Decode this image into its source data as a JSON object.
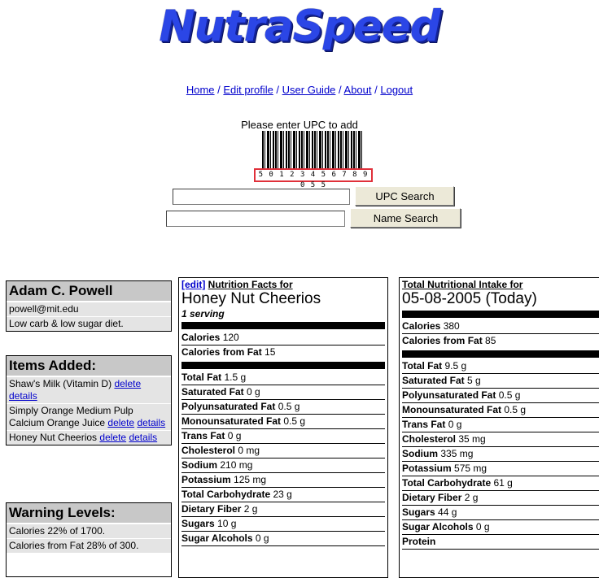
{
  "app": {
    "logo": "NutraSpeed"
  },
  "nav": {
    "items": [
      "Home",
      "Edit profile",
      "User Guide",
      "About",
      "Logout"
    ],
    "separator": " / "
  },
  "upc": {
    "prompt": "Please enter UPC to add",
    "barcode_digits": "5 0 1 2 3 4 5 6 7 8 9 0 5 5",
    "upc_input_value": "",
    "upc_button": "UPC Search",
    "name_input_value": "",
    "name_button": "Name Search"
  },
  "profile": {
    "name": "Adam C. Powell",
    "email": "powell@mit.edu",
    "diet": "Low carb & low sugar diet."
  },
  "items_added": {
    "title": "Items Added:",
    "items": [
      {
        "name": "Shaw's Milk (Vitamin D)",
        "delete": "delete",
        "details": "details"
      },
      {
        "name": "Simply Orange Medium Pulp Calcium Orange Juice",
        "delete": "delete",
        "details": "details"
      },
      {
        "name": "Honey Nut Cheerios",
        "delete": "delete",
        "details": "details"
      }
    ]
  },
  "warnings": {
    "title": "Warning Levels:",
    "items": [
      "Calories 22% of 1700.",
      "Calories from Fat 28% of 300."
    ]
  },
  "nutrition_facts": {
    "edit_link": "[edit]",
    "caption": "Nutrition Facts for",
    "product": "Honey Nut Cheerios",
    "serving": "1 serving",
    "calories_label": "Calories",
    "calories_value": "120",
    "cal_fat_label": "Calories from Fat",
    "cal_fat_value": "15",
    "rows": [
      {
        "label": "Total Fat",
        "value": "1.5 g"
      },
      {
        "label": "Saturated Fat",
        "value": "0 g"
      },
      {
        "label": "Polyunsaturated Fat",
        "value": "0.5 g"
      },
      {
        "label": "Monounsaturated Fat",
        "value": "0.5 g"
      },
      {
        "label": "Trans Fat",
        "value": "0 g"
      },
      {
        "label": "Cholesterol",
        "value": "0 mg"
      },
      {
        "label": "Sodium",
        "value": "210 mg"
      },
      {
        "label": "Potassium",
        "value": "125 mg"
      },
      {
        "label": "Total Carbohydrate",
        "value": "23 g"
      },
      {
        "label": "Dietary Fiber",
        "value": "2 g"
      },
      {
        "label": "Sugars",
        "value": "10 g"
      },
      {
        "label": "Sugar Alcohols",
        "value": "0 g"
      }
    ]
  },
  "total_intake": {
    "caption": "Total Nutritional Intake for",
    "date": "05-08-2005 (Today)",
    "calories_label": "Calories",
    "calories_value": "380",
    "cal_fat_label": "Calories from Fat",
    "cal_fat_value": "85",
    "rows": [
      {
        "label": "Total Fat",
        "value": "9.5 g"
      },
      {
        "label": "Saturated Fat",
        "value": "5 g"
      },
      {
        "label": "Polyunsaturated Fat",
        "value": "0.5 g"
      },
      {
        "label": "Monounsaturated Fat",
        "value": "0.5 g"
      },
      {
        "label": "Trans Fat",
        "value": "0 g"
      },
      {
        "label": "Cholesterol",
        "value": "35 mg"
      },
      {
        "label": "Sodium",
        "value": "335 mg"
      },
      {
        "label": "Potassium",
        "value": "575 mg"
      },
      {
        "label": "Total Carbohydrate",
        "value": "61 g"
      },
      {
        "label": "Dietary Fiber",
        "value": "2 g"
      },
      {
        "label": "Sugars",
        "value": "44 g"
      },
      {
        "label": "Sugar Alcohols",
        "value": "0 g"
      },
      {
        "label": "Protein",
        "value": ""
      }
    ]
  },
  "colors": {
    "link": "#0000cc",
    "logo": "#2b46e6",
    "header_gray": "#c8c8c8",
    "cell_gray": "#e4e4e4"
  }
}
